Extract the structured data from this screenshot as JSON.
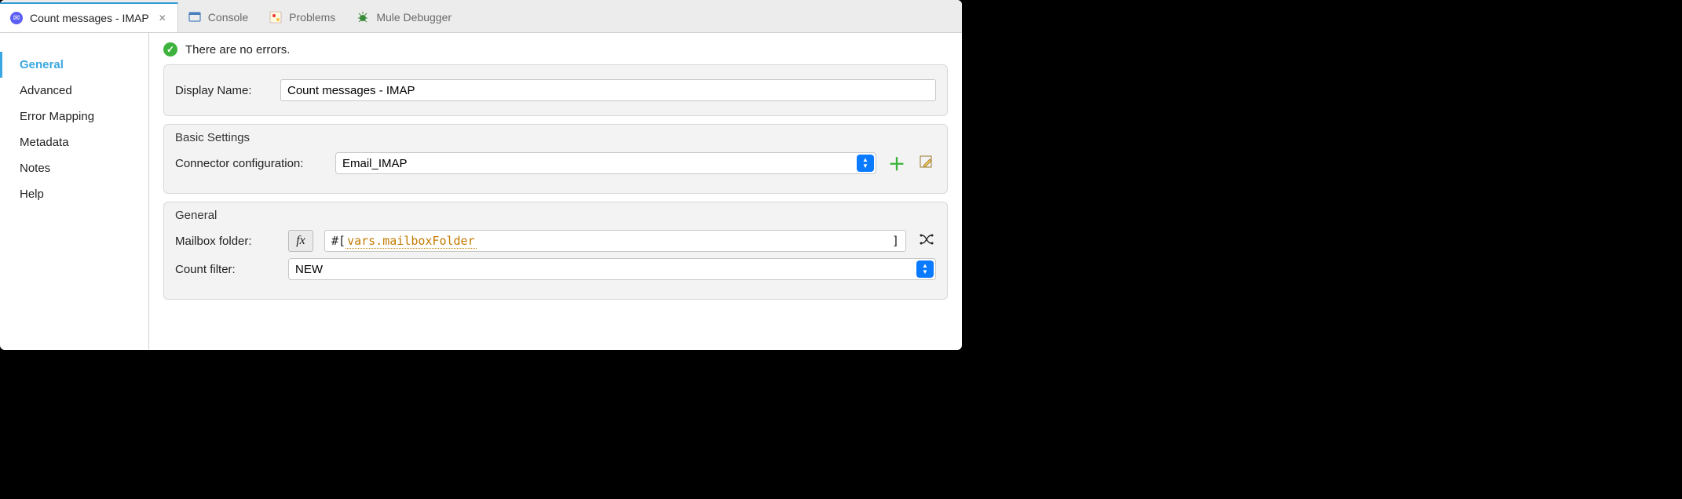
{
  "tabs": {
    "active": {
      "label": "Count messages - IMAP"
    },
    "console": {
      "label": "Console"
    },
    "problems": {
      "label": "Problems"
    },
    "debugger": {
      "label": "Mule Debugger"
    }
  },
  "sidebar": {
    "items": [
      {
        "label": "General"
      },
      {
        "label": "Advanced"
      },
      {
        "label": "Error Mapping"
      },
      {
        "label": "Metadata"
      },
      {
        "label": "Notes"
      },
      {
        "label": "Help"
      }
    ]
  },
  "status": {
    "text": "There are no errors."
  },
  "display_name": {
    "label": "Display Name:",
    "value": "Count messages - IMAP"
  },
  "basic_settings": {
    "title": "Basic Settings",
    "connector_label": "Connector configuration:",
    "connector_value": "Email_IMAP"
  },
  "general": {
    "title": "General",
    "mailbox_label": "Mailbox folder:",
    "mailbox_pre": "#[ ",
    "mailbox_var": "vars.mailboxFolder",
    "mailbox_post": " ]",
    "fx_label": "fx",
    "count_filter_label": "Count filter:",
    "count_filter_value": "NEW"
  }
}
